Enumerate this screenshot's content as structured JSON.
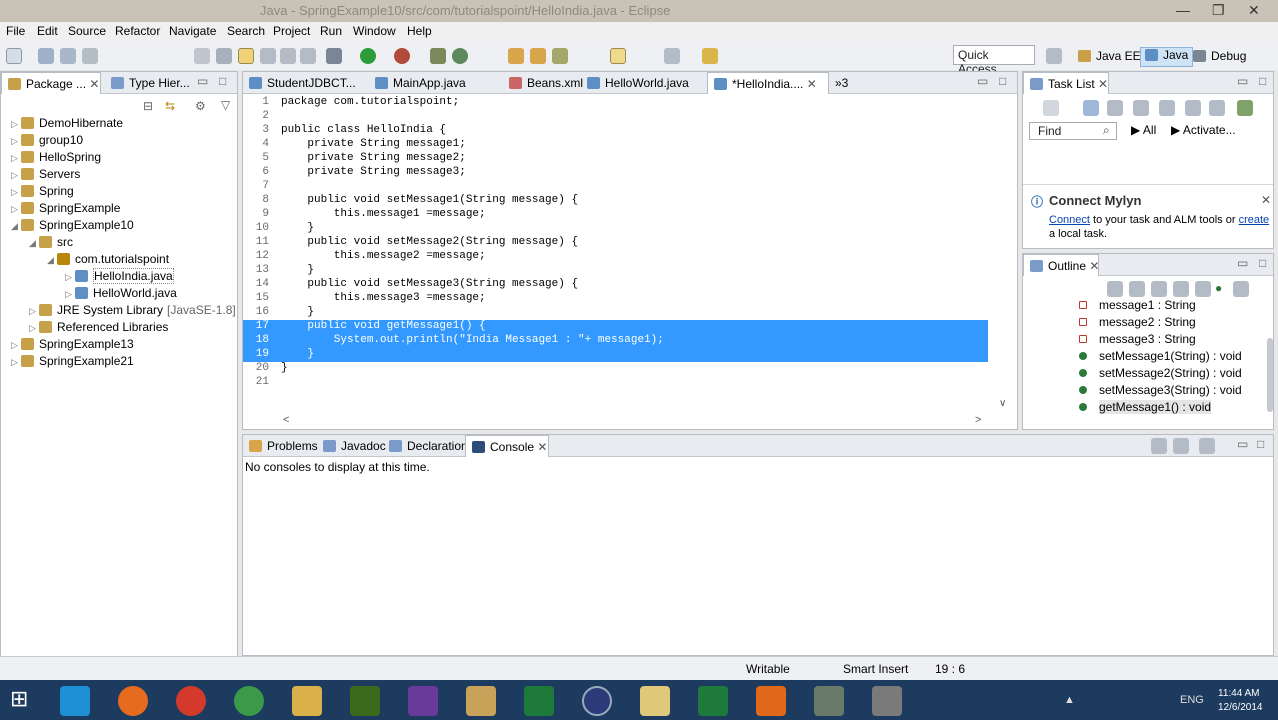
{
  "window": {
    "title": "Java - SpringExample10/src/com/tutorialspoint/HelloIndia.java - Eclipse"
  },
  "menu": [
    "File",
    "Edit",
    "Source",
    "Refactor",
    "Navigate",
    "Search",
    "Project",
    "Run",
    "Window",
    "Help"
  ],
  "quick_access": "Quick Access",
  "perspectives": [
    "Java EE",
    "Java",
    "Debug"
  ],
  "package_explorer": {
    "tabs": [
      "Package ...",
      "Type Hier..."
    ],
    "items": [
      {
        "label": "DemoHibernate",
        "level": 0,
        "tri": "▷"
      },
      {
        "label": "group10",
        "level": 0,
        "tri": "▷"
      },
      {
        "label": "HelloSpring",
        "level": 0,
        "tri": "▷"
      },
      {
        "label": "Servers",
        "level": 0,
        "tri": "▷"
      },
      {
        "label": "Spring",
        "level": 0,
        "tri": "▷"
      },
      {
        "label": "SpringExample",
        "level": 0,
        "tri": "▷"
      },
      {
        "label": "SpringExample10",
        "level": 0,
        "tri": "◢"
      },
      {
        "label": "src",
        "level": 1,
        "tri": "◢"
      },
      {
        "label": "com.tutorialspoint",
        "level": 2,
        "tri": "◢"
      },
      {
        "label": "HelloIndia.java",
        "level": 3,
        "tri": "▷"
      },
      {
        "label": "HelloWorld.java",
        "level": 3,
        "tri": "▷"
      },
      {
        "label": "JRE System Library",
        "extra": "[JavaSE-1.8]",
        "level": 1,
        "tri": "▷"
      },
      {
        "label": "Referenced Libraries",
        "level": 1,
        "tri": "▷"
      },
      {
        "label": "SpringExample13",
        "level": 0,
        "tri": "▷"
      },
      {
        "label": "SpringExample21",
        "level": 0,
        "tri": "▷"
      }
    ]
  },
  "editor": {
    "tabs": [
      "StudentJDBCT...",
      "MainApp.java",
      "Beans.xml",
      "HelloWorld.java",
      "*HelloIndia....",
      "»3"
    ],
    "lines": [
      {
        "n": "1",
        "t": "package com.tutorialspoint;"
      },
      {
        "n": "2",
        "t": ""
      },
      {
        "n": "3",
        "t": "public class HelloIndia {"
      },
      {
        "n": "4",
        "t": "    private String message1;"
      },
      {
        "n": "5",
        "t": "    private String message2;"
      },
      {
        "n": "6",
        "t": "    private String message3;"
      },
      {
        "n": "7",
        "t": ""
      },
      {
        "n": "8",
        "t": "    public void setMessage1(String message) {"
      },
      {
        "n": "9",
        "t": "        this.message1 =message;"
      },
      {
        "n": "10",
        "t": "    }"
      },
      {
        "n": "11",
        "t": "    public void setMessage2(String message) {"
      },
      {
        "n": "12",
        "t": "        this.message2 =message;"
      },
      {
        "n": "13",
        "t": "    }"
      },
      {
        "n": "14",
        "t": "    public void setMessage3(String message) {"
      },
      {
        "n": "15",
        "t": "        this.message3 =message;"
      },
      {
        "n": "16",
        "t": "    }"
      },
      {
        "n": "17",
        "t": "    public void getMessage1() {"
      },
      {
        "n": "18",
        "t": "        System.out.println(\"India Message1 : \"+ message1);"
      },
      {
        "n": "19",
        "t": "    }"
      },
      {
        "n": "20",
        "t": "}"
      },
      {
        "n": "21",
        "t": ""
      }
    ]
  },
  "task_list": {
    "tab": "Task List",
    "find_placeholder": "Find",
    "all": "All",
    "activate": "Activate..."
  },
  "mylyn": {
    "title": "Connect Mylyn",
    "link1": "Connect",
    "text1": " to your task and ALM tools or ",
    "link2": "create",
    "text2": "a local task."
  },
  "outline": {
    "tab": "Outline",
    "items": [
      {
        "label": "message1 : String",
        "kind": "field"
      },
      {
        "label": "message2 : String",
        "kind": "field"
      },
      {
        "label": "message3 : String",
        "kind": "field"
      },
      {
        "label": "setMessage1(String) : void",
        "kind": "method"
      },
      {
        "label": "setMessage2(String) : void",
        "kind": "method"
      },
      {
        "label": "setMessage3(String) : void",
        "kind": "method"
      },
      {
        "label": "getMessage1() : void",
        "kind": "method"
      }
    ]
  },
  "bottom": {
    "tabs": [
      "Problems",
      "Javadoc",
      "Declaration",
      "Console"
    ],
    "message": "No consoles to display at this time."
  },
  "status": {
    "writable": "Writable",
    "insert": "Smart Insert",
    "pos": "19 : 6"
  },
  "clock": {
    "time": "11:44 AM",
    "date": "12/6/2014",
    "lang": "ENG"
  },
  "colors": {
    "accent": "#3399ff",
    "keyword": "#7f0055",
    "field": "#0000c0"
  }
}
